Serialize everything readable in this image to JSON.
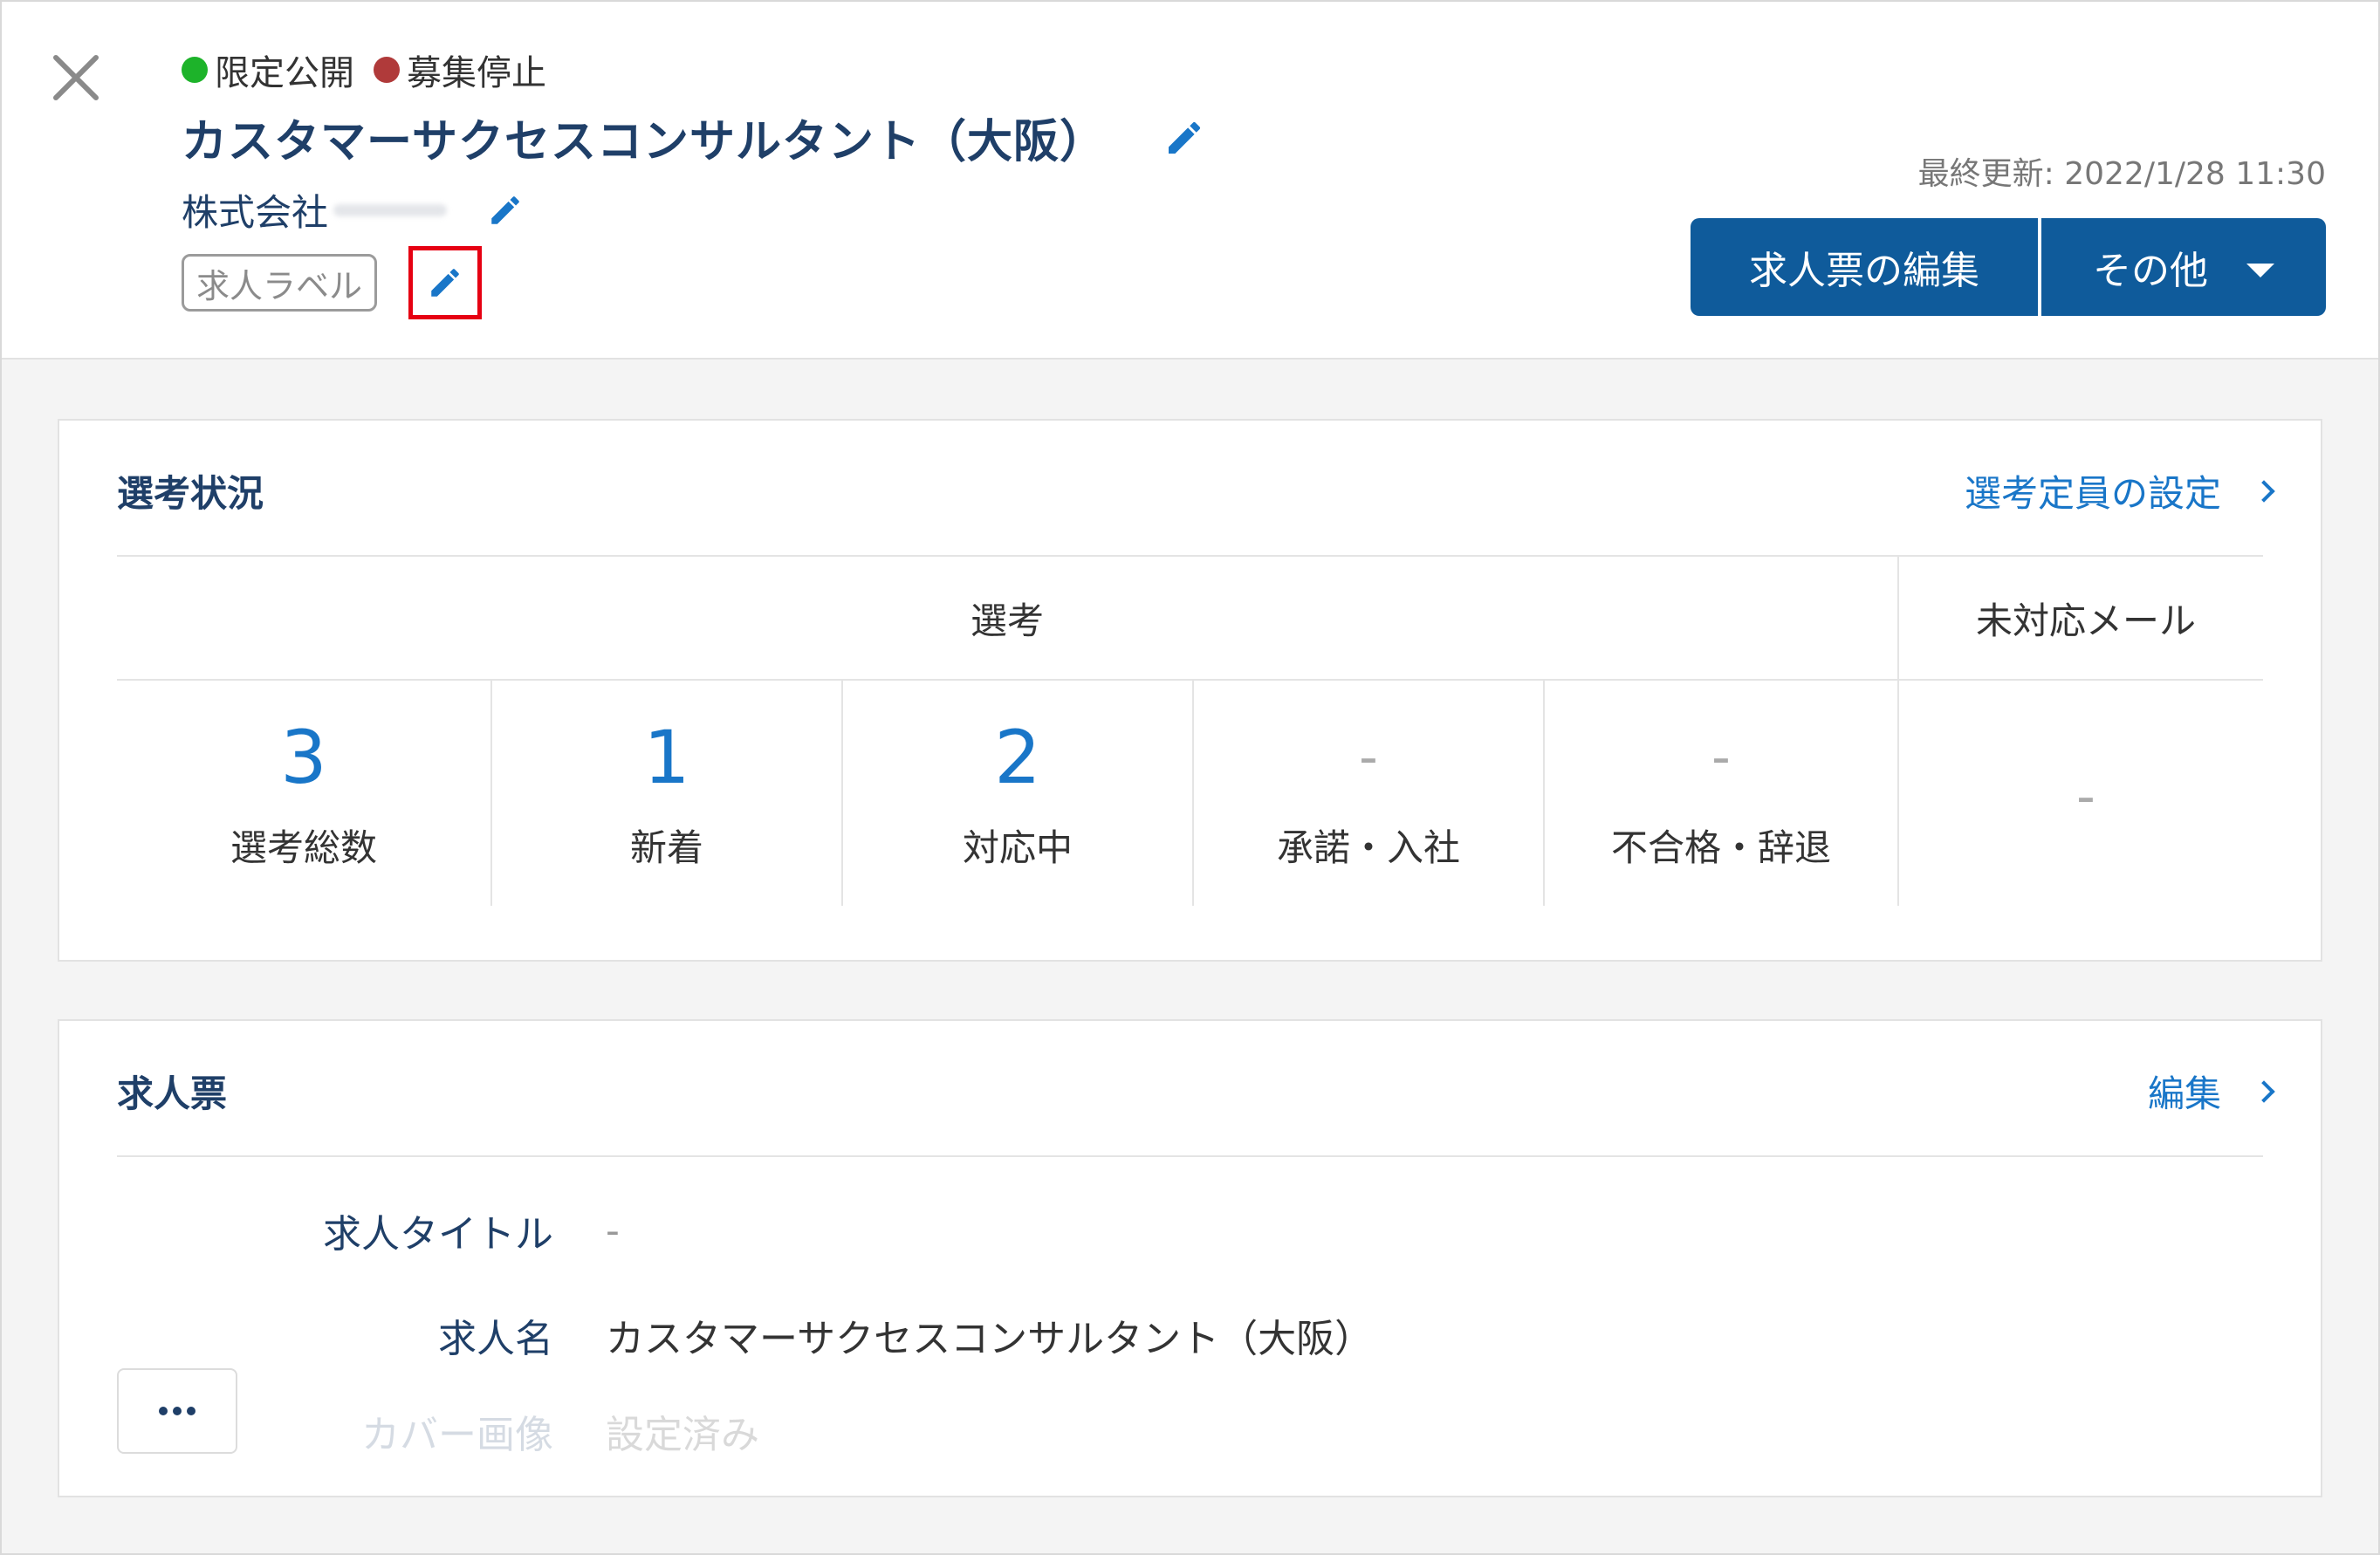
{
  "header": {
    "status": [
      {
        "label": "限定公開",
        "color": "#1db32a"
      },
      {
        "label": "募集停止",
        "color": "#b03a3a"
      }
    ],
    "title": "カスタマーサクセスコンサルタント（大阪）",
    "company": "株式会社",
    "job_label": "求人ラベル",
    "updated": "最終更新: 2022/1/28 11:30",
    "edit_button": "求人票の編集",
    "other_button": "その他"
  },
  "selection": {
    "heading": "選考状況",
    "link": "選考定員の設定",
    "col_selection": "選考",
    "col_mail": "未対応メール",
    "stats": [
      {
        "value": "3",
        "label": "選考総数"
      },
      {
        "value": "1",
        "label": "新着"
      },
      {
        "value": "2",
        "label": "対応中"
      },
      {
        "value": "-",
        "label": "承諾・入社"
      },
      {
        "value": "-",
        "label": "不合格・辞退"
      }
    ],
    "mail_value": "-"
  },
  "job_sheet": {
    "heading": "求人票",
    "link": "編集",
    "fields": [
      {
        "label": "求人タイトル",
        "value": "-"
      },
      {
        "label": "求人名",
        "value": "カスタマーサクセスコンサルタント（大阪）"
      },
      {
        "label": "カバー画像",
        "value": "設定済み"
      }
    ]
  },
  "colors": {
    "primary": "#0f5b9b",
    "link": "#1976c8",
    "navy": "#1f3f68",
    "highlight": "#e60012"
  }
}
